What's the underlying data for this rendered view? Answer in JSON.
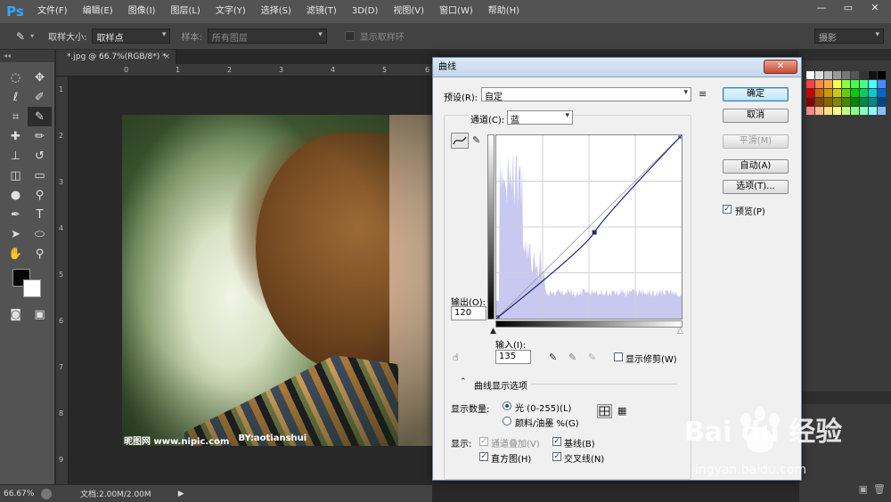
{
  "app": {
    "logo": "Ps",
    "menu": [
      "文件(F)",
      "编辑(E)",
      "图像(I)",
      "图层(L)",
      "文字(Y)",
      "选择(S)",
      "滤镜(T)",
      "3D(D)",
      "视图(V)",
      "窗口(W)",
      "帮助(H)"
    ],
    "window_controls": [
      "—",
      "▭",
      "✕"
    ]
  },
  "options_bar": {
    "sample_size_label": "取样大小:",
    "sample_size_value": "取样点",
    "sample_label": "样本:",
    "sample_value": "所有图层",
    "show_ring_label": "显示取样环",
    "workspace": "摄影"
  },
  "document": {
    "tab_title": "*.jpg @ 66.7%(RGB/8*) *",
    "tab_close": "×",
    "ruler_h": [
      "0",
      "1",
      "2",
      "3",
      "4",
      "5",
      "6"
    ],
    "ruler_v": [
      "1",
      "2",
      "3",
      "4",
      "5",
      "6",
      "7",
      "8",
      "9"
    ],
    "watermark_left": "昵图网 www.nipic.com",
    "watermark_right": "BY:aotianshui"
  },
  "status_bar": {
    "zoom": "66.67%",
    "doc_size": "文档:2.00M/2.00M",
    "arrow": "▶"
  },
  "curves": {
    "title": "曲线",
    "close": "✕",
    "preset_label": "预设(R):",
    "preset_value": "自定",
    "channel_label": "通道(C):",
    "channel_value": "蓝",
    "output_label": "输出(O):",
    "output_value": "120",
    "input_label": "输入(I):",
    "input_value": "135",
    "show_clipping": "显示修剪(W)",
    "display_options": "曲线显示选项",
    "show_amount_label": "显示数量:",
    "light_option": "光 (0-255)(L)",
    "pigment_option": "颜料/油墨 %(G)",
    "show_label": "显示:",
    "channel_overlay": "通道叠加(V)",
    "baseline": "基线(B)",
    "histogram": "直方图(H)",
    "intersection": "交叉线(N)",
    "buttons": {
      "ok": "确定",
      "cancel": "取消",
      "smooth": "平滑(M)",
      "auto": "自动(A)",
      "options": "选项(T)..."
    },
    "preview": "预览(P)",
    "curve_point": {
      "input": 135,
      "output": 120
    }
  },
  "baidu": {
    "brand": "Bai du 经验",
    "url": "jingyan.baidu.com"
  },
  "colors": {
    "ps_blue": "#31a8ff",
    "dialog_bg": "#f0f0f0",
    "histogram": "#c8c8f0",
    "curve": "#1c2a7a"
  }
}
